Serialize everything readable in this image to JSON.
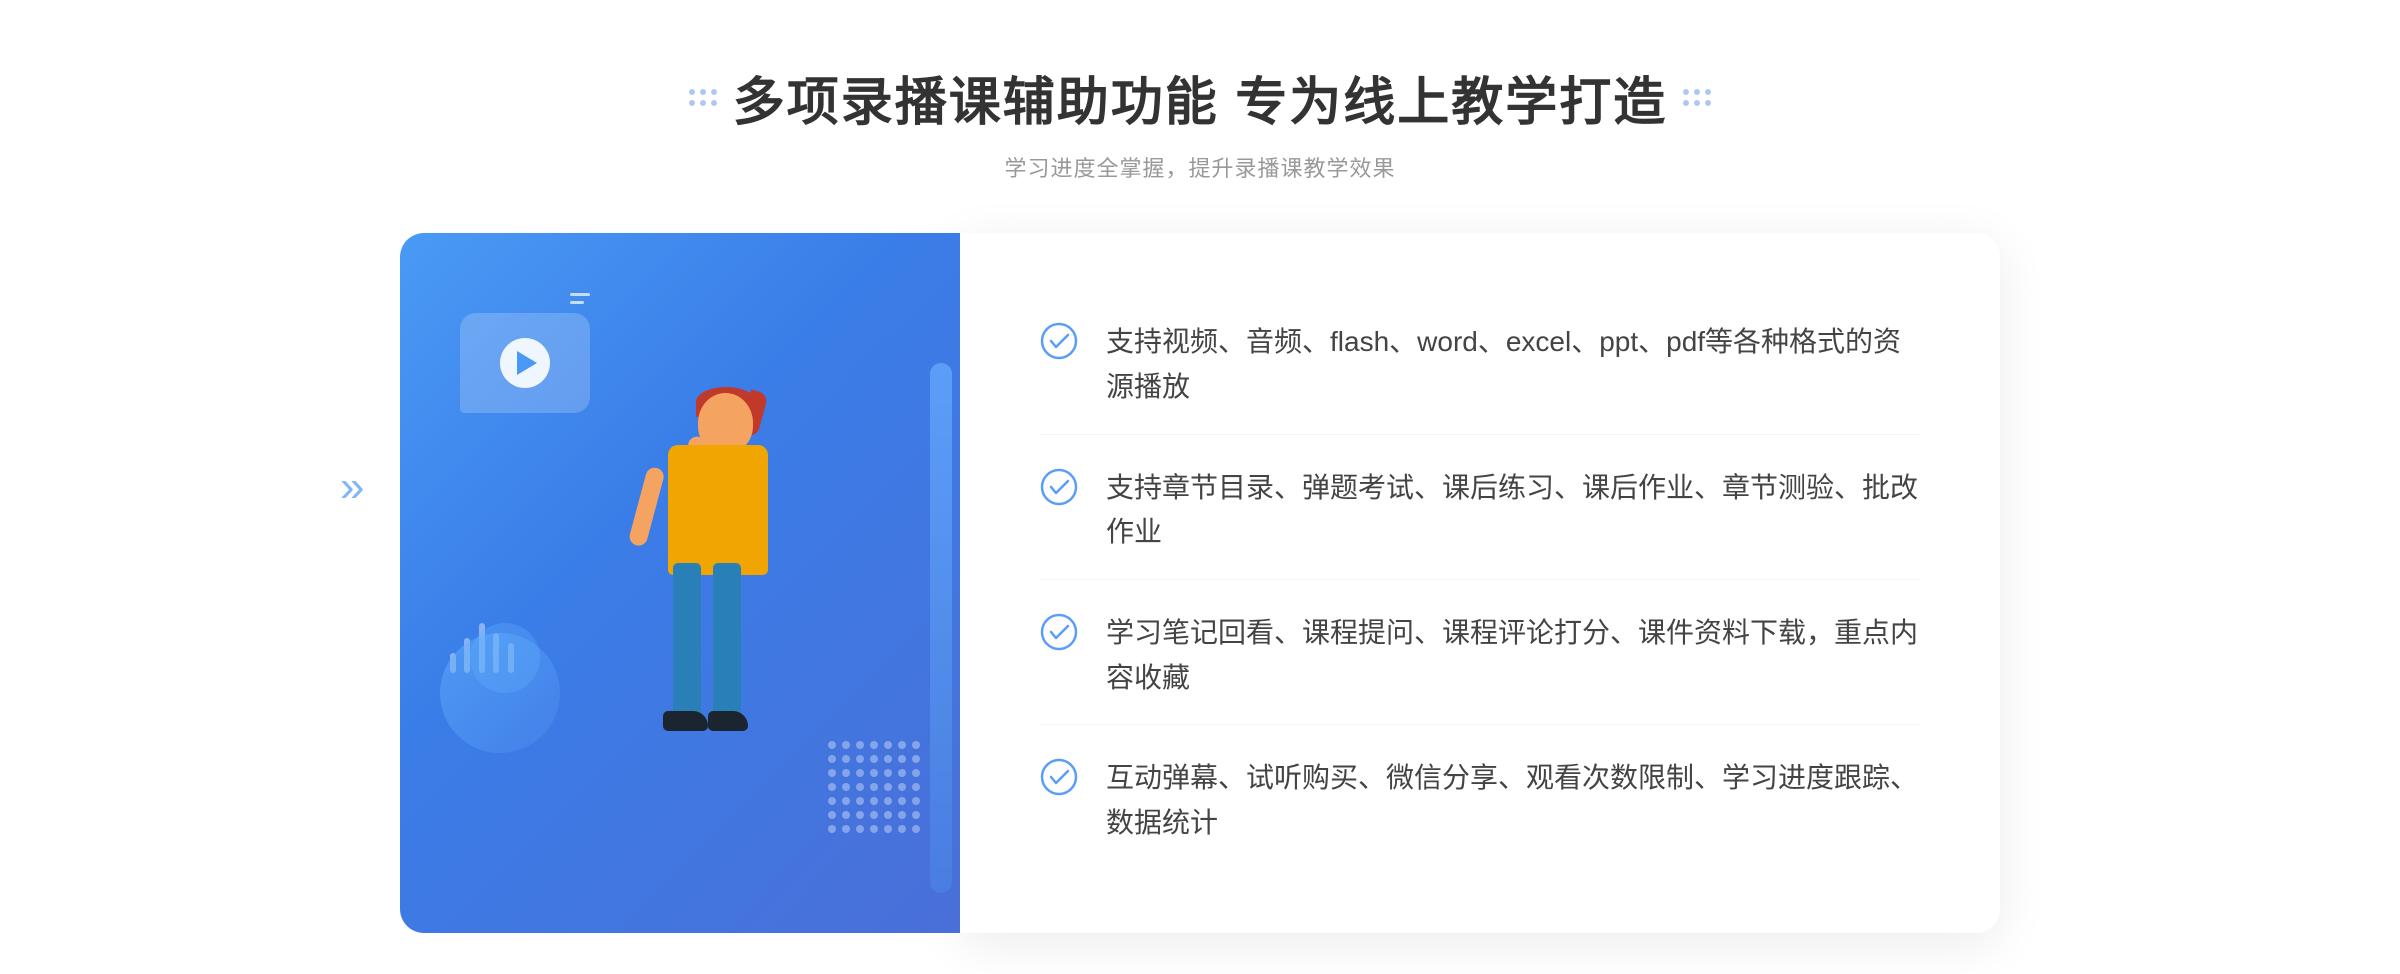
{
  "header": {
    "title": "多项录播课辅助功能 专为线上教学打造",
    "subtitle": "学习进度全掌握，提升录播课教学效果",
    "decorator_left": "❖",
    "decorator_right": "❖"
  },
  "features": [
    {
      "id": 1,
      "text": "支持视频、音频、flash、word、excel、ppt、pdf等各种格式的资源播放"
    },
    {
      "id": 2,
      "text": "支持章节目录、弹题考试、课后练习、课后作业、章节测验、批改作业"
    },
    {
      "id": 3,
      "text": "学习笔记回看、课程提问、课程评论打分、课件资料下载，重点内容收藏"
    },
    {
      "id": 4,
      "text": "互动弹幕、试听购买、微信分享、观看次数限制、学习进度跟踪、数据统计"
    }
  ],
  "colors": {
    "primary": "#4a9af5",
    "title": "#333333",
    "subtitle": "#999999",
    "feature_text": "#444444",
    "check_color": "#5b9ef8"
  },
  "chevrons": "»"
}
